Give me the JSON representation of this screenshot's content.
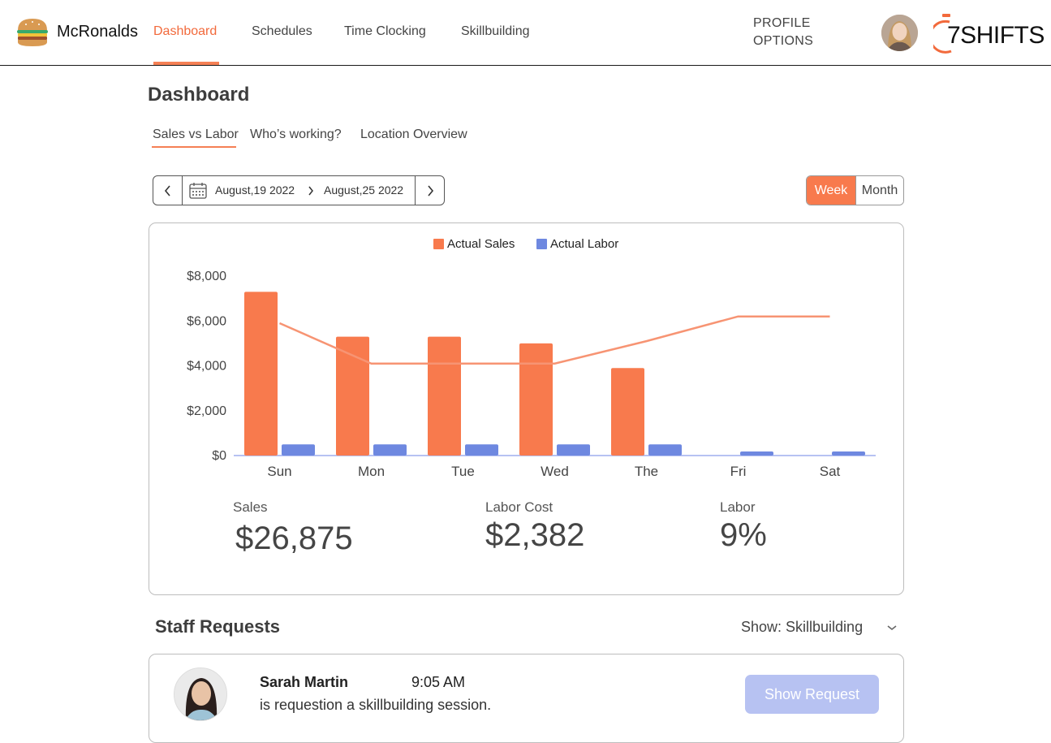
{
  "header": {
    "brand_name": "McRonalds",
    "nav": [
      "Dashboard",
      "Schedules",
      "Time Clocking",
      "Skillbuilding"
    ],
    "active_nav": "Dashboard",
    "profile_line1": "PROFILE",
    "profile_line2": "OPTIONS",
    "logo_text": "7SHIFTS",
    "accent_color": "#f87a4d"
  },
  "page": {
    "title": "Dashboard",
    "subtabs": [
      "Sales vs Labor",
      "Who’s working?",
      "Location Overview"
    ],
    "active_subtab": "Sales vs Labor"
  },
  "date_range": {
    "start": "August,19 2022",
    "end": "August,25 2022",
    "prev_icon": "chevron-left-icon",
    "next_icon": "chevron-right-icon",
    "calendar_icon": "calendar-icon"
  },
  "period_toggle": {
    "week": "Week",
    "month": "Month",
    "selected": "Week"
  },
  "chart_data": {
    "type": "bar",
    "categories": [
      "Sun",
      "Mon",
      "Tue",
      "Wed",
      "The",
      "Fri",
      "Sat"
    ],
    "series": [
      {
        "name": "Actual Sales",
        "type": "bar",
        "color": "#f87a4d",
        "values": [
          7300,
          5300,
          5300,
          5000,
          3900,
          0,
          0
        ]
      },
      {
        "name": "Actual Labor",
        "type": "bar",
        "color": "#6e88e0",
        "values": [
          500,
          500,
          500,
          500,
          500,
          180,
          180
        ]
      },
      {
        "type": "line",
        "color": "#f79473",
        "values": [
          5900,
          4100,
          4100,
          4100,
          5100,
          6200,
          6200
        ]
      }
    ],
    "yticks": [
      "$0",
      "$2,000",
      "$4,000",
      "$6,000",
      "$8,000"
    ],
    "ylim": [
      0,
      8000
    ],
    "legend_position": "top-center",
    "grid": false
  },
  "stats": [
    {
      "label": "Sales",
      "value": "$26,875"
    },
    {
      "label": "Labor Cost",
      "value": "$2,382"
    },
    {
      "label": "Labor",
      "value": "9%"
    }
  ],
  "staff_requests": {
    "title": "Staff Requests",
    "filter": "Show: Skillbuilding",
    "items": [
      {
        "name": "Sarah Martin",
        "time": "9:05 AM",
        "message": "is requestion a skillbuilding session.",
        "button": "Show Request"
      }
    ]
  }
}
